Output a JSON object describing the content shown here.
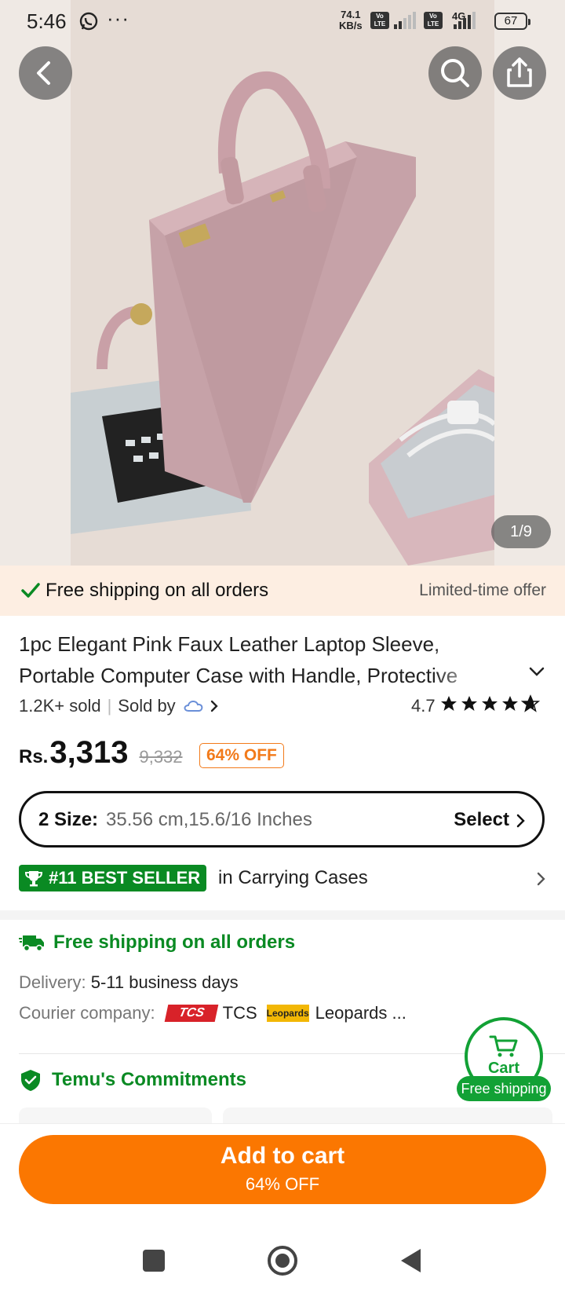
{
  "status_bar": {
    "time": "5:46",
    "net_speed_value": "74.1",
    "net_speed_unit": "KB/s",
    "network_1": "Vo LTE",
    "network_2": "Vo LTE",
    "network_type": "4G",
    "battery": "67"
  },
  "gallery": {
    "counter": "1/9"
  },
  "promo_banner": {
    "text": "Free shipping on all orders",
    "offer": "Limited-time offer"
  },
  "product": {
    "title": "1pc Elegant Pink Faux Leather Laptop Sleeve, Portable Computer Case with Handle, Protective",
    "sold": "1.2K+ sold",
    "sold_by_label": "Sold by",
    "rating": "4.7",
    "rating_value": 4.7,
    "price_currency": "Rs.",
    "price": "3,313",
    "original_price": "9,332",
    "discount": "64% OFF"
  },
  "size_selector": {
    "label": "2 Size:",
    "value": "35.56 cm,15.6/16 Inches",
    "action": "Select"
  },
  "best_seller": {
    "badge": "#11 BEST SELLER",
    "category": "in Carrying Cases"
  },
  "shipping": {
    "heading": "Free shipping on all orders",
    "delivery_label": "Delivery:",
    "delivery_value": "5-11 business days",
    "courier_label": "Courier company:",
    "courier_1_logo": "TCS",
    "courier_1": "TCS",
    "courier_2_logo": "Leopards",
    "courier_2": "Leopards ..."
  },
  "commitments": {
    "heading": "Temu's Commitments"
  },
  "floating_cart": {
    "label": "Cart",
    "badge": "Free shipping"
  },
  "add_to_cart": {
    "label": "Add to cart",
    "sub": "64% OFF"
  },
  "colors": {
    "accent_orange": "#fb7701",
    "green": "#0a8a23",
    "promo_bg": "#fdeee2"
  },
  "icons": [
    "back-icon",
    "search-icon",
    "share-icon",
    "check-icon",
    "chevron-down-icon",
    "star-icon",
    "chevron-right-icon",
    "trophy-icon",
    "truck-icon",
    "shield-icon",
    "cart-icon"
  ]
}
